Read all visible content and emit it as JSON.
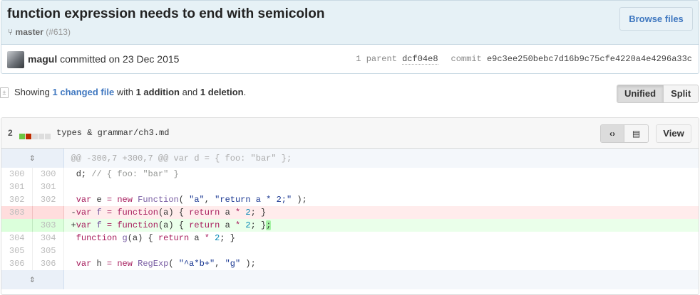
{
  "commit": {
    "title": "function expression needs to end with semicolon",
    "branch": "master",
    "pr": "(#613)",
    "browse_label": "Browse files",
    "author": "magul",
    "committed_text": "committed on 23 Dec 2015",
    "parent_label": "1 parent",
    "parent_sha": "dcf04e8",
    "commit_label": "commit",
    "commit_sha": "e9c3ee250bebc7d16b9c75cfe4220a4e4296a33c"
  },
  "summary": {
    "prefix": "Showing",
    "changed": "1 changed file",
    "with": "with",
    "additions": "1 addition",
    "and": "and",
    "deletions": "1 deletion",
    "end": "."
  },
  "view_toggle": {
    "unified": "Unified",
    "split": "Split",
    "selected": "Unified"
  },
  "file": {
    "changes": "2",
    "path": "types & grammar/ch3.md",
    "view_label": "View",
    "stat_colors": {
      "add": "#6cc644",
      "del": "#bd2c00",
      "neutral": "#ddd"
    },
    "hunk_header": "@@ -300,7 +300,7 @@ var d = { foo: \"bar\" };",
    "lines": [
      {
        "type": "ctx",
        "old": "300",
        "new": "300",
        "tokens": [
          [
            " d; ",
            ""
          ],
          [
            "// { foo: \"bar\" }",
            "cm"
          ]
        ]
      },
      {
        "type": "ctx",
        "old": "301",
        "new": "301",
        "tokens": [
          [
            " ",
            ""
          ]
        ]
      },
      {
        "type": "ctx",
        "old": "302",
        "new": "302",
        "tokens": [
          [
            " ",
            ""
          ],
          [
            "var",
            "k"
          ],
          [
            " e ",
            ""
          ],
          [
            "=",
            "k"
          ],
          [
            " ",
            ""
          ],
          [
            "new",
            "k"
          ],
          [
            " ",
            ""
          ],
          [
            "Function",
            "f"
          ],
          [
            "( ",
            ""
          ],
          [
            "\"a\"",
            "s"
          ],
          [
            ", ",
            ""
          ],
          [
            "\"return a * 2;\"",
            "s"
          ],
          [
            " );",
            ""
          ]
        ]
      },
      {
        "type": "del",
        "old": "303",
        "new": "",
        "tokens": [
          [
            "-",
            ""
          ],
          [
            "var",
            "k"
          ],
          [
            " ",
            ""
          ],
          [
            "f",
            "f"
          ],
          [
            " ",
            ""
          ],
          [
            "=",
            "k"
          ],
          [
            " ",
            ""
          ],
          [
            "function",
            "k"
          ],
          [
            "(a) { ",
            ""
          ],
          [
            "return",
            "k"
          ],
          [
            " a ",
            ""
          ],
          [
            "*",
            "k"
          ],
          [
            " ",
            ""
          ],
          [
            "2",
            "m"
          ],
          [
            "; }",
            ""
          ]
        ]
      },
      {
        "type": "add",
        "old": "",
        "new": "303",
        "tokens": [
          [
            "+",
            ""
          ],
          [
            "var",
            "k"
          ],
          [
            " ",
            ""
          ],
          [
            "f",
            "f"
          ],
          [
            " ",
            ""
          ],
          [
            "=",
            "k"
          ],
          [
            " ",
            ""
          ],
          [
            "function",
            "k"
          ],
          [
            "(a) { ",
            ""
          ],
          [
            "return",
            "k"
          ],
          [
            " a ",
            ""
          ],
          [
            "*",
            "k"
          ],
          [
            " ",
            ""
          ],
          [
            "2",
            "m"
          ],
          [
            "; }",
            ""
          ],
          [
            ";",
            "hl"
          ]
        ]
      },
      {
        "type": "ctx",
        "old": "304",
        "new": "304",
        "tokens": [
          [
            " ",
            ""
          ],
          [
            "function",
            "k"
          ],
          [
            " ",
            ""
          ],
          [
            "g",
            "f"
          ],
          [
            "(a) { ",
            ""
          ],
          [
            "return",
            "k"
          ],
          [
            " a ",
            ""
          ],
          [
            "*",
            "k"
          ],
          [
            " ",
            ""
          ],
          [
            "2",
            "m"
          ],
          [
            "; }",
            ""
          ]
        ]
      },
      {
        "type": "ctx",
        "old": "305",
        "new": "305",
        "tokens": [
          [
            " ",
            ""
          ]
        ]
      },
      {
        "type": "ctx",
        "old": "306",
        "new": "306",
        "tokens": [
          [
            " ",
            ""
          ],
          [
            "var",
            "k"
          ],
          [
            " h ",
            ""
          ],
          [
            "=",
            "k"
          ],
          [
            " ",
            ""
          ],
          [
            "new",
            "k"
          ],
          [
            " ",
            ""
          ],
          [
            "RegExp",
            "f"
          ],
          [
            "( ",
            ""
          ],
          [
            "\"^a*b+\"",
            "s"
          ],
          [
            ", ",
            ""
          ],
          [
            "\"g\"",
            "s"
          ],
          [
            " );",
            ""
          ]
        ]
      }
    ]
  }
}
